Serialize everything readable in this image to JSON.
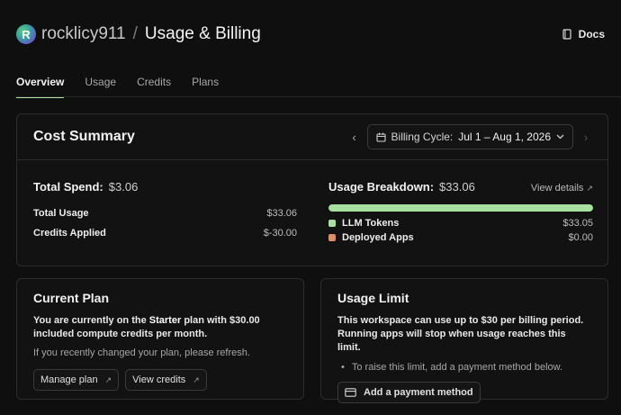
{
  "header": {
    "avatar_letter": "R",
    "workspace": "rocklicy911",
    "separator": "/",
    "page_title": "Usage & Billing",
    "docs_label": "Docs"
  },
  "tabs": [
    {
      "label": "Overview",
      "active": true
    },
    {
      "label": "Usage",
      "active": false
    },
    {
      "label": "Credits",
      "active": false
    },
    {
      "label": "Plans",
      "active": false
    }
  ],
  "cost_summary": {
    "title": "Cost Summary",
    "prev_arrow": "‹",
    "next_arrow": "›",
    "billing_cycle_label": "Billing Cycle:",
    "billing_cycle_value": "Jul 1 – Aug 1, 2026",
    "total_spend_label": "Total Spend:",
    "total_spend_value": "$3.06",
    "total_usage_label": "Total Usage",
    "total_usage_value": "$33.06",
    "credits_applied_label": "Credits Applied",
    "credits_applied_value": "$-30.00",
    "breakdown_label": "Usage Breakdown:",
    "breakdown_value": "$33.06",
    "view_details_label": "View details",
    "breakdown_items": [
      {
        "label": "LLM Tokens",
        "value": "$33.05",
        "color": "#a8e0a0",
        "fraction": 1.0
      },
      {
        "label": "Deployed Apps",
        "value": "$0.00",
        "color": "#e08a6e",
        "fraction": 0.0
      }
    ]
  },
  "current_plan": {
    "title": "Current Plan",
    "text_prefix": "You are currently on the",
    "plan_name": "Starter",
    "text_suffix": "plan with $30.00 included compute credits per month.",
    "refresh_note": "If you recently changed your plan, please refresh.",
    "manage_plan_label": "Manage plan",
    "view_credits_label": "View credits"
  },
  "usage_limit": {
    "title": "Usage Limit",
    "text": "This workspace can use up to $30 per billing period. Running apps will stop when usage reaches this limit.",
    "bullet": "To raise this limit, add a payment method below.",
    "add_payment_label": "Add a payment method"
  },
  "colors": {
    "accent": "#aee3a4",
    "background": "#0f0f10",
    "card_border": "#2c2c2e"
  }
}
